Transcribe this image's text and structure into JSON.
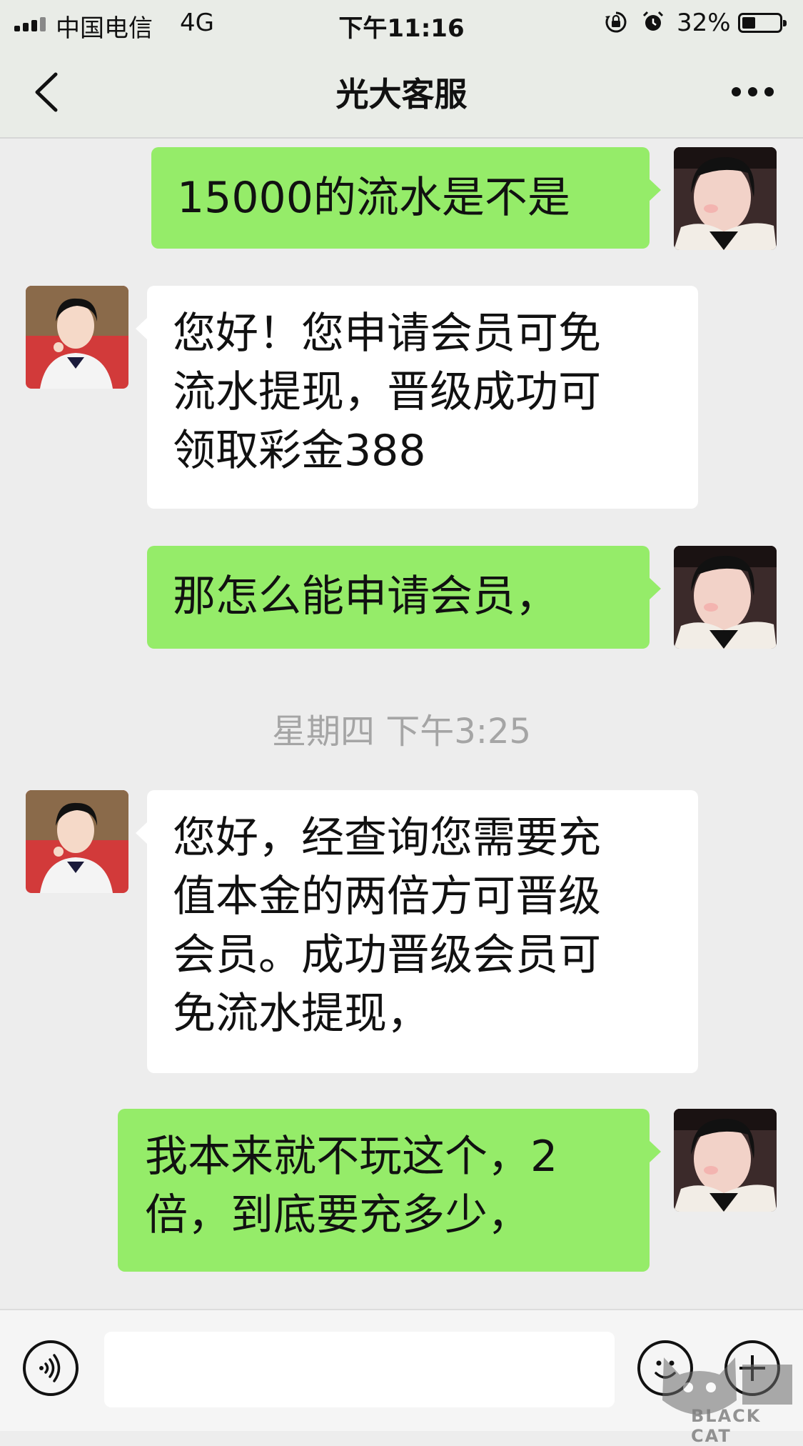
{
  "status_bar": {
    "carrier": "中国电信",
    "network": "4G",
    "time": "下午11:16",
    "battery_percent": "32%",
    "battery_level": 0.32,
    "icons": [
      "signal-bars-icon",
      "orientation-lock-icon",
      "alarm-icon",
      "battery-icon"
    ]
  },
  "nav": {
    "title": "光大客服",
    "back_icon": "chevron-left-icon",
    "more_icon": "more-dots-icon"
  },
  "messages": [
    {
      "side": "right",
      "sender": "me",
      "text": "15000的流水是不是"
    },
    {
      "side": "left",
      "sender": "service",
      "lines": [
        "您好！您申请会员可免",
        "流水提现，晋级成功可",
        "领取彩金388"
      ]
    },
    {
      "side": "right",
      "sender": "me",
      "text": "那怎么能申请会员，"
    },
    {
      "side": "left",
      "sender": "service",
      "lines": [
        "您好，经查询您需要充",
        "值本金的两倍方可晋级",
        "会员。成功晋级会员可",
        "免流水提现，"
      ]
    },
    {
      "side": "right",
      "sender": "me",
      "lines": [
        "我本来就不玩这个，2",
        "倍，到底要充多少，"
      ]
    }
  ],
  "timestamp": "星期四 下午3:25",
  "input_bar": {
    "voice_icon": "voice-icon",
    "emoji_icon": "emoji-icon",
    "plus_icon": "plus-icon",
    "input_value": ""
  },
  "watermark": {
    "text": "BLACK CAT",
    "logo": "black-cat-logo"
  },
  "colors": {
    "outgoing_bubble": "#95ec69",
    "incoming_bubble": "#ffffff",
    "background": "#ededed",
    "timestamp": "#a5a5a5"
  }
}
